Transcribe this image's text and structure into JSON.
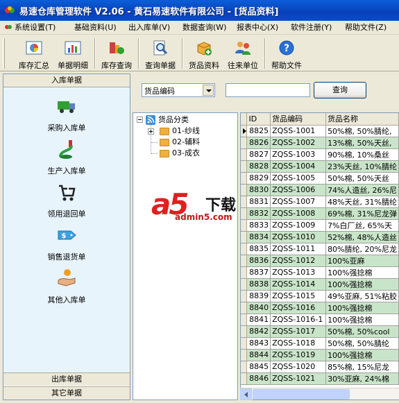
{
  "window": {
    "title": "易速仓库管理软件 V2.06 - 黄石易速软件有限公司 - [货品资料]"
  },
  "menu": [
    "系统设置(T)",
    "基础资料(U)",
    "出入库单(V)",
    "数据查询(W)",
    "报表中心(X)",
    "软件注册(Y)",
    "帮助文件(Z)"
  ],
  "toolbar": [
    {
      "label": "库存汇总",
      "icon": "pie-chart-icon"
    },
    {
      "label": "单据明细",
      "icon": "bar-chart-icon"
    },
    {
      "label": "库存查询",
      "icon": "inventory-icon"
    },
    {
      "label": "查询单据",
      "icon": "magnifier-document-icon"
    },
    {
      "label": "货品资料",
      "icon": "goods-box-icon"
    },
    {
      "label": "往来单位",
      "icon": "contacts-icon"
    },
    {
      "label": "帮助文件",
      "icon": "help-icon"
    }
  ],
  "left_panel": {
    "header": "入库单据",
    "items": [
      {
        "label": "采购入库单",
        "icon": "truck-icon"
      },
      {
        "label": "生产入库单",
        "icon": "production-icon"
      },
      {
        "label": "领用退回单",
        "icon": "return-cart-icon"
      },
      {
        "label": "销售退货单",
        "icon": "price-tag-icon"
      },
      {
        "label": "其他入库单",
        "icon": "hand-icon"
      }
    ],
    "footer_tabs": [
      "出库单据",
      "其它单据"
    ]
  },
  "search": {
    "field_selected": "货品编码",
    "input_value": "",
    "button_label": "查询"
  },
  "tree": {
    "root": "货品分类",
    "children": [
      "01-纱线",
      "02-辅料",
      "03-成衣"
    ]
  },
  "grid": {
    "columns": [
      "ID",
      "货品编码",
      "货品名称"
    ],
    "rows": [
      [
        "8825",
        "ZQSS-1001",
        "50%棉, 50%腈纶,"
      ],
      [
        "8826",
        "ZQSS-1002",
        "13%棉, 50%天丝,"
      ],
      [
        "8827",
        "ZQSS-1003",
        "90%棉, 10%桑丝"
      ],
      [
        "8828",
        "ZQSS-1004",
        "23%天丝, 10%腈纶"
      ],
      [
        "8829",
        "ZQSS-1005",
        "50%棉, 50%天丝"
      ],
      [
        "8830",
        "ZQSS-1006",
        "74%人造丝, 26%尼"
      ],
      [
        "8831",
        "ZQSS-1007",
        "48%天丝, 31%腈纶"
      ],
      [
        "8832",
        "ZQSS-1008",
        "69%棉, 31%尼龙弹"
      ],
      [
        "8833",
        "ZQSS-1009",
        "7%白厂丝, 65%天"
      ],
      [
        "8834",
        "ZQSS-1010",
        "52%棉, 48%人造丝"
      ],
      [
        "8835",
        "ZQSS-1011",
        "80%腈纶, 20%尼龙"
      ],
      [
        "8836",
        "ZQSS-1012",
        "100%亚麻"
      ],
      [
        "8837",
        "ZQSS-1013",
        "100%强捻棉"
      ],
      [
        "8838",
        "ZQSS-1014",
        "100%强捻棉"
      ],
      [
        "8839",
        "ZQSS-1015",
        "49%亚麻, 51%粘胶"
      ],
      [
        "8840",
        "ZQSS-1016",
        "100%强捻棉"
      ],
      [
        "8841",
        "ZQSS-1016-1",
        "100%强捻棉"
      ],
      [
        "8842",
        "ZQSS-1017",
        "50%棉, 50%cool"
      ],
      [
        "8843",
        "ZQSS-1018",
        "50%棉, 50%腈纶"
      ],
      [
        "8844",
        "ZQSS-1019",
        "100%强捻棉"
      ],
      [
        "8845",
        "ZQSS-1020",
        "85%棉, 15%尼龙"
      ],
      [
        "8846",
        "ZQSS-1021",
        "30%亚麻, 24%棉"
      ]
    ]
  },
  "watermark": {
    "logo": "a5",
    "text": "下载",
    "url": "admin5.com"
  },
  "colors": {
    "title_bar": "#0A4CC8",
    "row_alt": "#C9E5C9",
    "panel_bg": "#E8F4FC",
    "chrome": "#ECE9D8"
  }
}
